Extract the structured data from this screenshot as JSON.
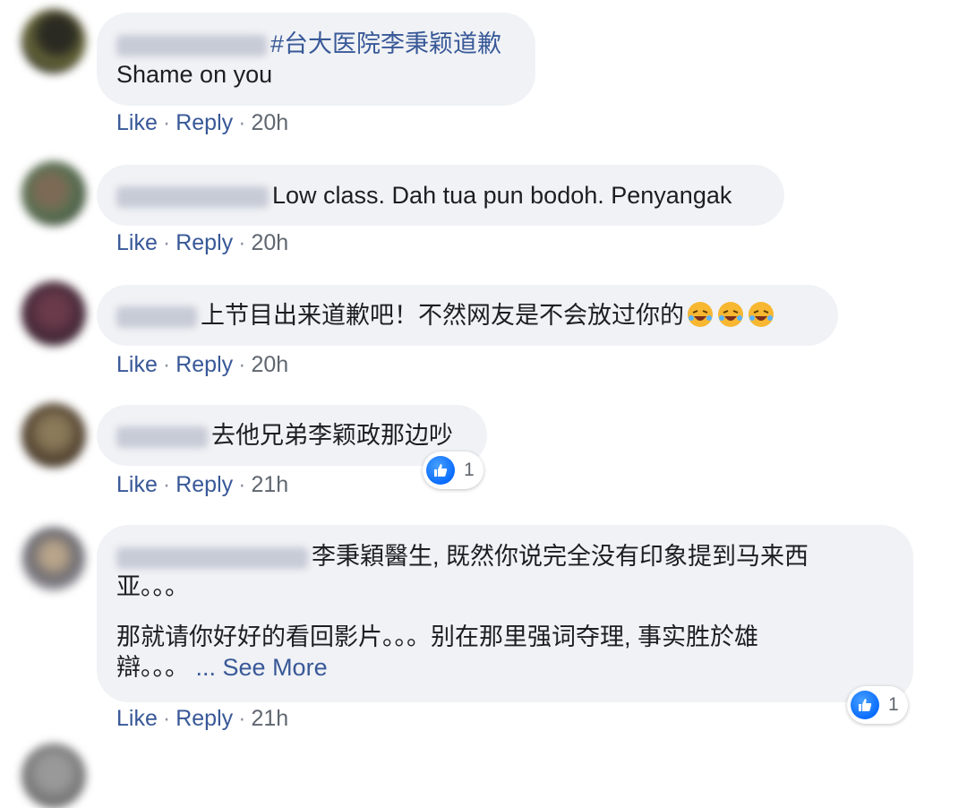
{
  "comments": [
    {
      "hashtag": "#台大医院李秉颖道歉",
      "text": "Shame on you",
      "actions": {
        "like": "Like",
        "reply": "Reply",
        "time": "20h"
      }
    },
    {
      "text": "Low class. Dah tua pun bodoh. Penyangak",
      "actions": {
        "like": "Like",
        "reply": "Reply",
        "time": "20h"
      }
    },
    {
      "text": "上节目出来道歉吧！不然网友是不会放过你的",
      "emoji": [
        "rolling-laughing-emoji",
        "rolling-laughing-emoji",
        "rolling-laughing-emoji"
      ],
      "actions": {
        "like": "Like",
        "reply": "Reply",
        "time": "20h"
      }
    },
    {
      "text": "去他兄弟李颖政那边吵",
      "reaction_count": "1",
      "actions": {
        "like": "Like",
        "reply": "Reply",
        "time": "21h"
      }
    },
    {
      "text_line1": "李秉穎醫生, 既然你说完全没有印象提到马来西",
      "text_line2": "亚。。。",
      "text_line3": "那就请你好好的看回影片。。。别在那里强词夺理, 事实胜於雄",
      "text_line4": "辯。。。",
      "see_more": "... See More",
      "reaction_count": "1",
      "actions": {
        "like": "Like",
        "reply": "Reply",
        "time": "21h"
      }
    }
  ],
  "colors": {
    "bubble": "#f0f2f5",
    "link": "#385898",
    "text": "#1c1e21",
    "like_blue": "#0a6cff"
  }
}
